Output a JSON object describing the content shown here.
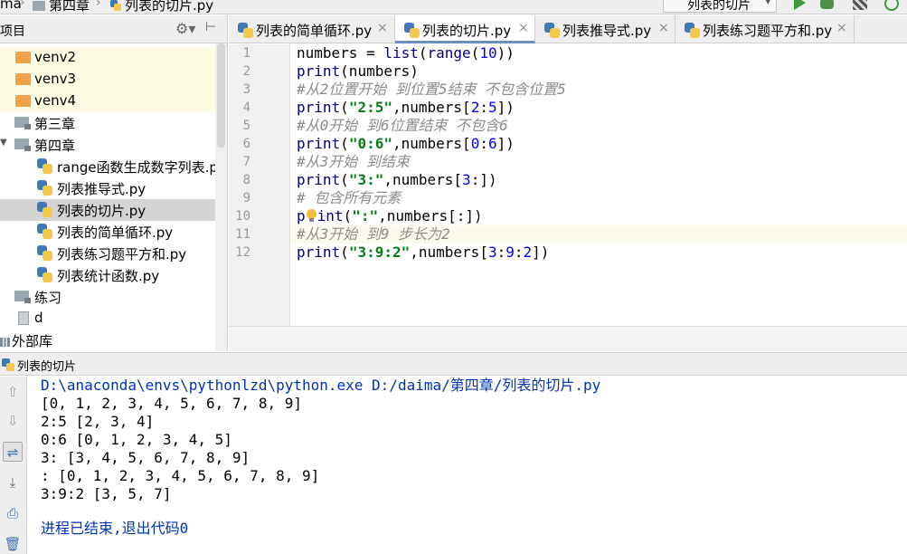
{
  "breadcrumb": {
    "items": [
      "ma",
      "第四章",
      "列表的切片.py"
    ]
  },
  "run_config": {
    "label": "列表的切片"
  },
  "project_panel": {
    "title": "项目",
    "tree": [
      {
        "label": "venv2",
        "type": "excluded-folder"
      },
      {
        "label": "venv3",
        "type": "excluded-folder"
      },
      {
        "label": "venv4",
        "type": "excluded-folder"
      },
      {
        "label": "第三章",
        "type": "folder",
        "expanded": false
      },
      {
        "label": "第四章",
        "type": "folder",
        "expanded": true
      },
      {
        "label": "range函数生成数字列表.py",
        "type": "python-file"
      },
      {
        "label": "列表推导式.py",
        "type": "python-file"
      },
      {
        "label": "列表的切片.py",
        "type": "python-file",
        "selected": true
      },
      {
        "label": "列表的简单循环.py",
        "type": "python-file"
      },
      {
        "label": "列表练习题平方和.py",
        "type": "python-file"
      },
      {
        "label": "列表统计函数.py",
        "type": "python-file"
      },
      {
        "label": "练习",
        "type": "folder"
      },
      {
        "label": "d",
        "type": "file"
      },
      {
        "label": "外部库",
        "type": "library"
      }
    ]
  },
  "editor_tabs": [
    {
      "label": "列表的简单循环.py",
      "active": false
    },
    {
      "label": "列表的切片.py",
      "active": true
    },
    {
      "label": "列表推导式.py",
      "active": false
    },
    {
      "label": "列表练习题平方和.py",
      "active": false
    }
  ],
  "editor": {
    "line_numbers": [
      "1",
      "2",
      "3",
      "4",
      "5",
      "6",
      "7",
      "8",
      "9",
      "10",
      "11",
      "12"
    ],
    "current_line": "11",
    "tokens": {
      "l1_a": "numbers = ",
      "l1_b": "list",
      "l1_c": "(",
      "l1_d": "range",
      "l1_e": "(",
      "l1_f": "10",
      "l1_g": "))",
      "l2_a": "print",
      "l2_b": "(numbers)",
      "l3": "#从2位置开始 到位置5结束 不包含位置5",
      "l4_a": "print",
      "l4_b": "(",
      "l4_c": "\"2:5\"",
      "l4_d": ",numbers[",
      "l4_e": "2",
      "l4_f": ":",
      "l4_g": "5",
      "l4_h": "])",
      "l5": "#从0开始 到6位置结束 不包含6",
      "l6_a": "print",
      "l6_b": "(",
      "l6_c": "\"0:6\"",
      "l6_d": ",numbers[",
      "l6_e": "0",
      "l6_f": ":",
      "l6_g": "6",
      "l6_h": "])",
      "l7": "#从3开始 到结束",
      "l8_a": "print",
      "l8_b": "(",
      "l8_c": "\"3:\"",
      "l8_d": ",numbers[",
      "l8_e": "3",
      "l8_f": ":])",
      "l9": "# 包含所有元素",
      "l10_a": "p",
      "l10_b": "int",
      "l10_c": "(",
      "l10_d": "\":\"",
      "l10_e": ",numbers[:])",
      "l11": "#从3开始 到9 步长为2",
      "l12_a": "print",
      "l12_b": "(",
      "l12_c": "\"3:9:2\"",
      "l12_d": ",numbers[",
      "l12_e": "3",
      "l12_f": ":",
      "l12_g": "9",
      "l12_h": ":",
      "l12_i": "2",
      "l12_j": "])"
    }
  },
  "run_panel": {
    "title": "列表的切片",
    "output": [
      "D:\\anaconda\\envs\\pythonlzd\\python.exe D:/daima/第四章/列表的切片.py",
      "[0, 1, 2, 3, 4, 5, 6, 7, 8, 9]",
      "2:5 [2, 3, 4]",
      "0:6 [0, 1, 2, 3, 4, 5]",
      "3: [3, 4, 5, 6, 7, 8, 9]",
      ": [0, 1, 2, 3, 4, 5, 6, 7, 8, 9]",
      "3:9:2 [3, 5, 7]",
      "",
      "进程已结束,退出代码0"
    ]
  },
  "colors": {
    "keyword": "#000080",
    "number": "#0000ff",
    "string": "#067d17",
    "comment": "#8c8c8c",
    "excluded_folder_bg": "#fdfbe2",
    "selected_row_bg": "#d4d4d4",
    "current_line_bg": "#fcfaed",
    "console_command": "#0033b3"
  }
}
